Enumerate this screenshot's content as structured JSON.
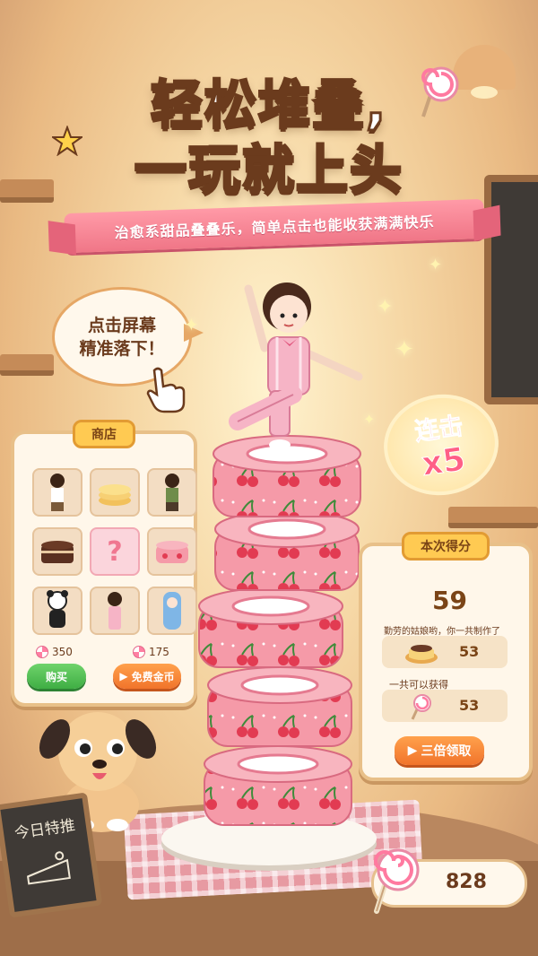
{
  "title": {
    "line1_a": "轻松",
    "line1_b": "堆叠",
    "line1_c": ",",
    "line2_a": "一玩就",
    "line2_b": "上头"
  },
  "subtitle": "治愈系甜品叠叠乐，简单点击也能收获满满快乐",
  "tip_bubble": {
    "line1": "点击屏幕",
    "line2": "精准落下！"
  },
  "combo": {
    "label": "连击",
    "multiplier": "x5"
  },
  "shop": {
    "title": "商店",
    "items": [
      {
        "name": "boy-figure",
        "type": "figure"
      },
      {
        "name": "stacked-pancakes",
        "type": "dessert"
      },
      {
        "name": "girl-figure",
        "type": "figure"
      },
      {
        "name": "chocolate-cake",
        "type": "dessert"
      },
      {
        "name": "mystery-item",
        "type": "unknown",
        "label": "?"
      },
      {
        "name": "cherry-roll-cake",
        "type": "dessert"
      },
      {
        "name": "panda-costume-figure",
        "type": "figure"
      },
      {
        "name": "pink-pajama-figure",
        "type": "figure"
      },
      {
        "name": "blue-costume-figure",
        "type": "figure"
      }
    ],
    "price1": "350",
    "price2": "175",
    "buy_label": "购买",
    "free_coins_label": "免费金币"
  },
  "score": {
    "title": "本次得分",
    "value": "59",
    "message": "勤劳的姑娘哟，你一共制作了",
    "made_count": "53",
    "earn_label": "一共可以获得",
    "earn_count": "53",
    "triple_label": "三倍领取"
  },
  "sign": {
    "text": "今日特推"
  },
  "candy_total": "828",
  "colors": {
    "accent_pink": "#f07687",
    "title_outline": "#6b3b1d",
    "highlight_yellow": "#ffd24a",
    "green_button": "#3fae44",
    "orange_button": "#f1742b"
  }
}
